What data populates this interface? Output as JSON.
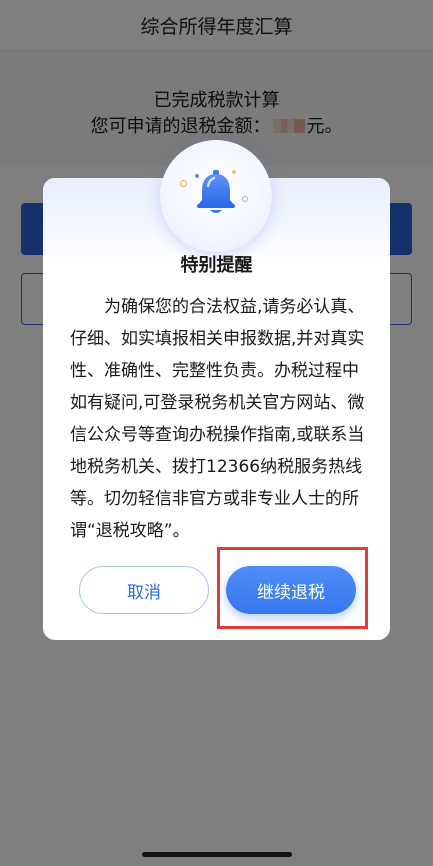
{
  "page": {
    "title": "综合所得年度汇算",
    "status": "已完成税款计算",
    "refund_prefix": "您可申请的退税金额：",
    "refund_suffix": "元。"
  },
  "dialog": {
    "title": "特别提醒",
    "body": "为确保您的合法权益,请务必认真、仔细、如实填报相关申报数据,并对真实性、准确性、完整性负责。办税过程中如有疑问,可登录税务机关官方网站、微信公众号等查询办税操作指南,或联系当地税务机关、拨打12366纳税服务热线等。切勿轻信非官方或非专业人士的所谓“退税攻略”。",
    "cancel_label": "取消",
    "continue_label": "继续退税",
    "icon": "bell-icon"
  },
  "colors": {
    "primary": "#3677ee",
    "highlight": "#e23b3b",
    "overlay": "rgba(0,0,0,0.5)"
  }
}
